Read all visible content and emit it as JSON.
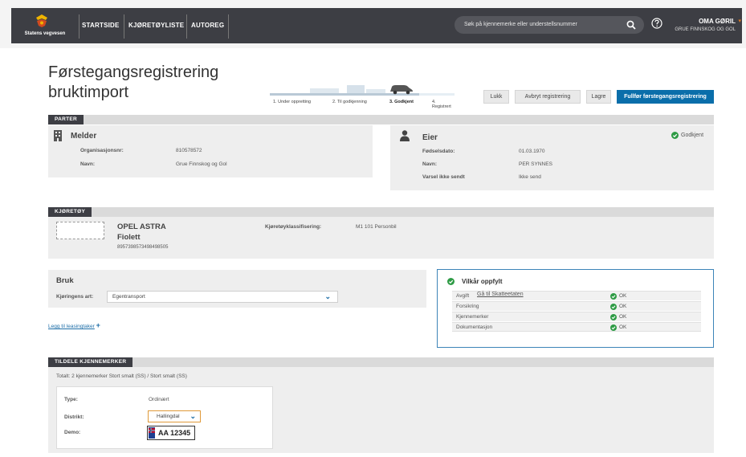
{
  "header": {
    "logo_text": "Statens vegvesen",
    "nav": [
      "STARTSIDE",
      "KJØRETØYLISTE",
      "AUTOREG"
    ],
    "search_placeholder": "Søk på kjennemerke eller understellsnummer",
    "user_name": "OMA GØRIL",
    "user_org": "GRUE FINNSKOG OG GOL",
    "colors": {
      "bar": "#3d3e44",
      "accent": "#e07b22",
      "primary": "#0a6eaa",
      "ok": "#2e9b45"
    }
  },
  "page": {
    "title_line1": "Førstegangsregistrering",
    "title_line2": "bruktimport"
  },
  "progress": {
    "steps": [
      "1. Under oppretting",
      "2. Til godkjenning",
      "3. Godkjent",
      "4. Registrert"
    ],
    "active_index": 2
  },
  "actions": {
    "lukk": "Lukk",
    "avbryt": "Avbryt registrering",
    "lagre": "Lagre",
    "fullfor": "Fullfør førstegangsregistrering"
  },
  "parter": {
    "section_label": "PARTER",
    "melder": {
      "title": "Melder",
      "org_label": "Organisasjonsnr:",
      "org_value": "810578572",
      "name_label": "Navn:",
      "name_value": "Grue Finnskog og Gol"
    },
    "eier": {
      "title": "Eier",
      "status": "Godkjent",
      "dob_label": "Fødselsdato:",
      "dob_value": "01.03.1970",
      "name_label": "Navn:",
      "name_value": "PER SYNNES",
      "varsel_label": "Varsel ikke sendt",
      "varsel_value": "Ikke send"
    }
  },
  "kjoretoy": {
    "section_label": "KJØRETØY",
    "make": "OPEL ASTRA",
    "color": "Fiolett",
    "vin": "8957398573498498505",
    "class_label": "Kjøretøyklassifisering:",
    "class_value": "M1 101 Personbil"
  },
  "bruk": {
    "title": "Bruk",
    "art_label": "Kjøringens art:",
    "art_value": "Egentransport",
    "leasing_link": "Legg til leasingtaker"
  },
  "vilkar": {
    "title": "Vilkår oppfylt",
    "rows": [
      {
        "label": "Avgift",
        "link": "Gå til Skatteetaten",
        "status": "OK"
      },
      {
        "label": "Forsikring",
        "link": "",
        "status": "OK"
      },
      {
        "label": "Kjennemerker",
        "link": "",
        "status": "OK"
      },
      {
        "label": "Dokumentasjon",
        "link": "",
        "status": "OK"
      }
    ]
  },
  "kjennemerker": {
    "section_label": "TILDELE KJENNEMERKER",
    "summary": "Totalt: 2 kjennemerker Stort smalt (SS) / Stort smalt (SS)",
    "type_label": "Type:",
    "type_value": "Ordinært",
    "distrikt_label": "Distrikt:",
    "distrikt_value": "Hallingdal",
    "demo_label": "Demo:",
    "demo_plate": "AA 12345"
  }
}
